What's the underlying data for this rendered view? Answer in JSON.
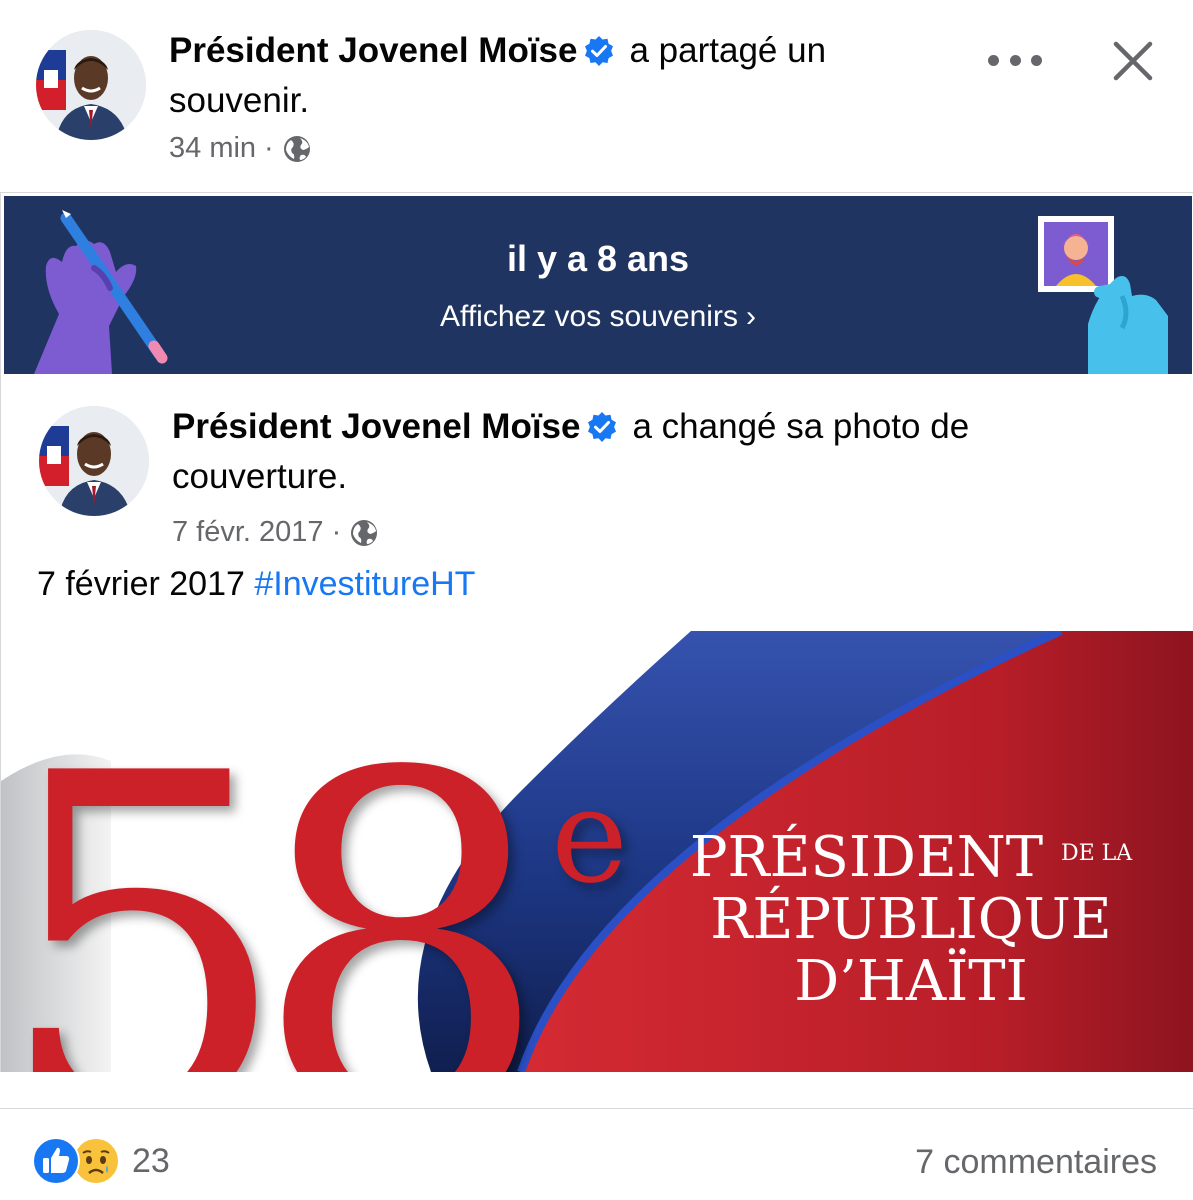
{
  "post": {
    "author": "Président Jovenel Moïse",
    "action": "a partagé un souvenir.",
    "time": "34 min",
    "separator": "·",
    "privacy_icon": "globe-icon"
  },
  "memory": {
    "title": "il y a 8 ans",
    "link_label": "Affichez vos souvenirs",
    "link_chevron": "›"
  },
  "shared_post": {
    "author": "Président Jovenel Moïse",
    "action": "a changé sa photo de couverture.",
    "date": "7 févr. 2017",
    "separator": "·",
    "caption_text": "7 février 2017",
    "caption_hashtag": "#InvestitureHT"
  },
  "cover": {
    "number": "58",
    "superscript": "e",
    "line1": "PRÉSIDENT",
    "line1_small": "DE LA",
    "line2": "RÉPUBLIQUE",
    "line3": "D’HAÏTI"
  },
  "footer": {
    "reaction_count": "23",
    "comments": "7 commentaires",
    "reaction_icons": [
      "like-icon",
      "sad-icon"
    ]
  },
  "colors": {
    "banner_bg": "#1f3461",
    "link_blue": "#1877f2",
    "verified_blue": "#1877f2",
    "cover_red": "#c8202c",
    "cover_blue": "#1a3a8a"
  }
}
